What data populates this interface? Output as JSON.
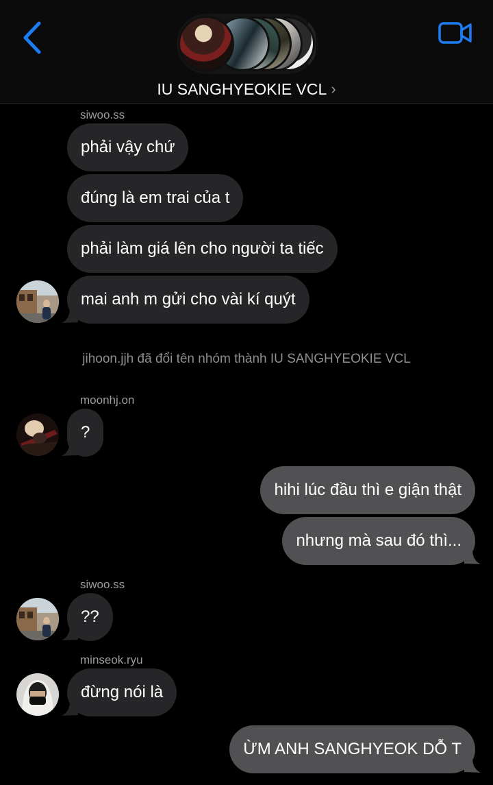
{
  "header": {
    "group_name": "IU SANGHYEOKIE VCL",
    "back_icon": "chevron-left-icon",
    "video_icon": "video-call-icon",
    "accent_color": "#1e7cf2"
  },
  "messages": {
    "group1": {
      "sender": "siwoo.ss",
      "texts": [
        "phải vậy chứ",
        "đúng là em trai của t",
        "phải làm giá lên cho người ta tiếc",
        "mai anh m gửi cho vài kí quýt"
      ]
    },
    "system": "jihoon.jjh đã đổi tên nhóm thành IU SANGHYEOKIE VCL",
    "group2": {
      "sender": "moonhj.on",
      "texts": [
        "?"
      ]
    },
    "outgoing1": {
      "texts": [
        "hihi lúc đầu thì e giận thật",
        "nhưng mà sau đó thì..."
      ]
    },
    "group3": {
      "sender": "siwoo.ss",
      "texts": [
        "??"
      ]
    },
    "group4": {
      "sender": "minseok.ryu",
      "texts": [
        "đừng nói là"
      ]
    },
    "outgoing2": {
      "texts": [
        "ỪM ANH SANGHYEOK DỖ T"
      ]
    }
  },
  "colors": {
    "incoming_bubble": "#262628",
    "outgoing_bubble": "#515153",
    "background": "#000000"
  }
}
